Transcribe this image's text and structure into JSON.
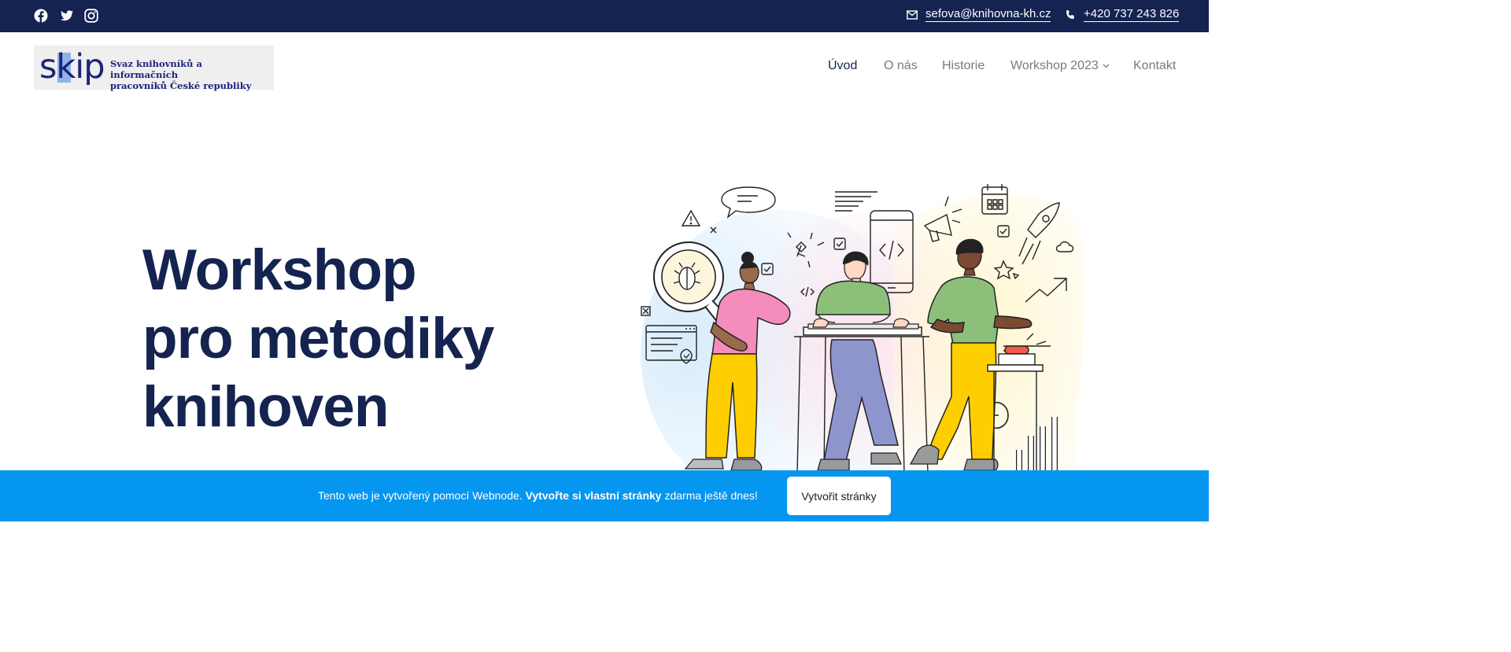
{
  "topbar": {
    "social": [
      {
        "name": "facebook-icon"
      },
      {
        "name": "twitter-icon"
      },
      {
        "name": "instagram-icon"
      }
    ],
    "email": "sefova@knihovna-kh.cz",
    "phone": "+420 737 243 826",
    "background": "#14234f"
  },
  "logo": {
    "word": "skip",
    "subtitle_line1": "Svaz knihovníků a informačních",
    "subtitle_line2": "pracovníků České republiky"
  },
  "nav": {
    "items": [
      {
        "label": "Úvod",
        "active": true
      },
      {
        "label": "O nás"
      },
      {
        "label": "Historie"
      },
      {
        "label": "Workshop 2023",
        "dropdown": true
      },
      {
        "label": "Kontakt"
      }
    ]
  },
  "hero": {
    "title_lines": [
      "Workshop",
      "pro metodiky",
      "knihoven"
    ],
    "title_color": "#14234f"
  },
  "banner": {
    "text_pre": "Tento web je vytvořený pomocí Webnode.",
    "text_bold": "Vytvořte si vlastní stránky",
    "text_post": "zdarma ještě dnes!",
    "button": "Vytvořit stránky",
    "background": "#0596f0"
  }
}
